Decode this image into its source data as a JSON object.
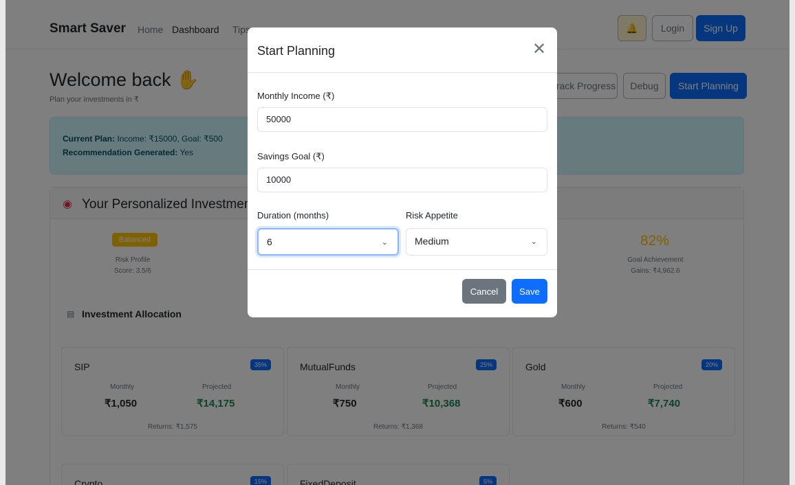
{
  "nav": {
    "brand": "Smart Saver",
    "links": [
      "Home",
      "Dashboard",
      "Tips"
    ],
    "bell_icon": "bell-icon",
    "login": "Login",
    "signup": "Sign Up"
  },
  "header": {
    "welcome": "Welcome back",
    "subtitle": "Plan your investments in ₹",
    "wave_icon": "wave-hand-icon",
    "actions": [
      "Track Progress",
      "Debug",
      "Start Planning"
    ]
  },
  "alert": {
    "current_plan_label": "Current Plan:",
    "current_plan_value": "Income: ₹15000, Goal: ₹500",
    "recommendation_label": "Recommendation Generated:",
    "recommendation_value": "Yes"
  },
  "card": {
    "title": "Your Personalized Investment",
    "icon": "target-icon",
    "risk_badge": "Balanced",
    "risk_label": "Risk Profile",
    "risk_score": "Score: 3.5/6",
    "goal_pct": "82%",
    "goal_label": "Goal Achievement",
    "goal_gains": "Gains: ₹4,962.6",
    "allocation_title": "Investment Allocation",
    "allocation_icon": "chart-icon"
  },
  "investments": [
    {
      "name": "SIP",
      "pct": "35%",
      "monthly_label": "Monthly",
      "monthly": "₹1,050",
      "projected_label": "Projected",
      "projected": "₹14,175",
      "returns": "Returns: ₹1,575"
    },
    {
      "name": "MutualFunds",
      "pct": "25%",
      "monthly_label": "Monthly",
      "monthly": "₹750",
      "projected_label": "Projected",
      "projected": "₹10,368",
      "returns": "Returns: ₹1,368"
    },
    {
      "name": "Gold",
      "pct": "20%",
      "monthly_label": "Monthly",
      "monthly": "₹600",
      "projected_label": "Projected",
      "projected": "₹7,740",
      "returns": "Returns: ₹540"
    },
    {
      "name": "Crypto",
      "pct": "15%"
    },
    {
      "name": "FixedDeposit",
      "pct": "5%"
    }
  ],
  "modal": {
    "title": "Start Planning",
    "close_icon": "close-icon",
    "income_label": "Monthly Income (₹)",
    "income_value": "50000",
    "goal_label": "Savings Goal (₹)",
    "goal_value": "10000",
    "duration_label": "Duration (months)",
    "duration_value": "6",
    "risk_label": "Risk Appetite",
    "risk_value": "Medium",
    "cancel": "Cancel",
    "save": "Save"
  }
}
